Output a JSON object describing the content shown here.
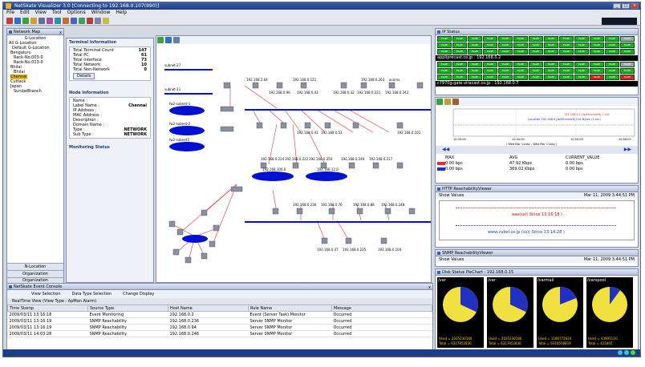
{
  "window": {
    "title": "NetSkate Visualizer 3.0 [Connecting to 192.168.0.107(990)]"
  },
  "menu": [
    "File",
    "Edit",
    "View",
    "Tool",
    "Options",
    "Window",
    "Help"
  ],
  "network_map": {
    "title": "Network Map",
    "tree": [
      "G-Location",
      "All G-Location",
      "Default G-Location",
      "Bengaluru",
      "Rack-No.003-0",
      "Rack-No.013-0",
      "Bhilai",
      "Bhilai",
      "Chennai",
      "Cuttack",
      "Japan",
      "SundaiBranch"
    ],
    "nav_buttons": [
      "N-Location",
      "Organization",
      "Organization"
    ]
  },
  "terminal_info": {
    "title": "Terminal Information",
    "rows": [
      {
        "k": "Total Terminal Count",
        "v": "147"
      },
      {
        "k": "Total PC",
        "v": "61"
      },
      {
        "k": "Total Interface",
        "v": "73"
      },
      {
        "k": "Total Network",
        "v": "10"
      },
      {
        "k": "Total Non-Network",
        "v": "0"
      }
    ],
    "details": "Details"
  },
  "node_info": {
    "title": "Node Information",
    "rows": [
      {
        "k": "Name :",
        "v": ""
      },
      {
        "k": "Label Name :",
        "v": "Chennai"
      },
      {
        "k": "IP Address :",
        "v": ""
      },
      {
        "k": "MAC Address :",
        "v": ""
      },
      {
        "k": "Description :",
        "v": ""
      },
      {
        "k": "Domain Name :",
        "v": ""
      },
      {
        "k": "Type :",
        "v": "NETWORK"
      },
      {
        "k": "Sub Type :",
        "v": "NETWORK"
      }
    ]
  },
  "monitoring": {
    "title": "Monitoring Status"
  },
  "map_labels": {
    "subnets": [
      "subnet-27",
      "subnet-11",
      "fw2-subnet-1",
      "fw2-subnet-2",
      "fw2-subnet3"
    ],
    "nets": [
      "192.168.100.0",
      "192.168.12.0"
    ],
    "hosts": [
      "192.168.2.64",
      "192.168.0.121",
      "192.168.0.263",
      "acorns",
      "192.168.0.96",
      "192.168.0.43",
      "192.168.0.32",
      "192.168.0.221",
      "192.168.0.242",
      "192.168.0.41",
      "192.168.0.51",
      "192.168.0.101",
      "192.168.0.224",
      "192.168.0.222",
      "192.168.0.250",
      "192.168.0.246",
      "192.168.0.217",
      "192.168.0.236",
      "192.168.0.76",
      "192.168.0.88",
      "192.168.0.248",
      "192.168.0.47",
      "192.168.0.225",
      "192.168.0.104"
    ]
  },
  "event_console": {
    "title": "NetSkate Event Console",
    "tabs": [
      "View Selection",
      "Data Type Selection",
      "Change Display"
    ],
    "subtitle": "RealTime View (View Type : ApMan Alarm)",
    "columns": [
      "Time Stamp",
      "Source Type",
      "Host Name",
      "Rule Name",
      "Message"
    ],
    "rows": [
      [
        "2009/03/11 13:16:18",
        "Event Monitoring",
        "192.168.0.2",
        "Event (Server Task) Monitor",
        "Occurred"
      ],
      [
        "2009/03/11 13:16:19",
        "SNMP Reachability",
        "192.168.0.236",
        "Server SNMP Monitor",
        "Occurred"
      ],
      [
        "2009/03/11 13:16:19",
        "SNMP Reachability",
        "192.168.0.94",
        "Server SNMP Monitor",
        "Occurred"
      ],
      [
        "2009/03/11 14:03:28",
        "SNMP Reachability",
        "192.168.0.246",
        "Server SNMP Monitor",
        "Occurred"
      ]
    ]
  },
  "ip_status": {
    "title": "IP Status",
    "row1": [
      "FastE",
      "FastE",
      "FastE",
      "FastE",
      "FastE",
      "FastE",
      "FastE",
      "FastE",
      "FastE",
      "FastE",
      "FastE",
      "FastE",
      "FastE"
    ],
    "bar1": "appliprecast.co.jp : 192.168.0.2",
    "bar2": "c7970g.gate.viracast.co.jp : 192.168.0.7"
  },
  "traffic": {
    "times": [
      "10:30:00",
      "10:40:00",
      "10:50:00",
      "10:56:00"
    ],
    "caption": "( Wed Mar 11day - Wed Mar 11day )",
    "legend": [
      "LocalNet 192.168.0 [fwEthernet6] Out Bytes (1 sec)",
      "192.168.0.2 [fwEthernet6] 1 sec"
    ],
    "cols": [
      "MAX",
      "AVG",
      "CURRENT_VALUE"
    ],
    "rows": [
      [
        "0.00 bps",
        "47.92 Kbps",
        "0.00 bps"
      ],
      [
        "0.00 bps",
        "369.02 Kbps",
        "0.00 bps"
      ]
    ]
  },
  "http_viewer": {
    "title": "HTTP ReachabilityViewer",
    "show": "Show Values",
    "date": "Mar 11, 2009 3:44:51 PM",
    "line1": "aaa(ss)( Since 13:16:18 )",
    "line2": "www.cubel.co.jp (ss)( Since 13:14:28 )"
  },
  "snmp_viewer": {
    "title": "SNMP ReachabilityViewer",
    "show": "Show Values",
    "date": "Mar 11, 2009 3:44:51 PM"
  },
  "disk_status": {
    "title": "Disk Status PieChart : 192.168.0.15",
    "pies": [
      {
        "cap": "/var",
        "used": "Used = 2025230180",
        "total": "Total = 6317852836",
        "fraction": 0.32
      },
      {
        "cap": "/var",
        "used": "Used = 2025230180",
        "total": "Total = 6317852836",
        "fraction": 0.32
      },
      {
        "cap": "/varmail",
        "used": "Used = 1180772624",
        "total": "Total = 6316558819",
        "fraction": 0.19
      },
      {
        "cap": "/varspool",
        "used": "Used = 4390113G",
        "total": "Total = 431805",
        "fraction": 0.1
      }
    ]
  },
  "colors": {
    "accent": "#1d3d85",
    "ok": "#18b020",
    "alarm": "#e02020",
    "net": "#0010d0"
  }
}
